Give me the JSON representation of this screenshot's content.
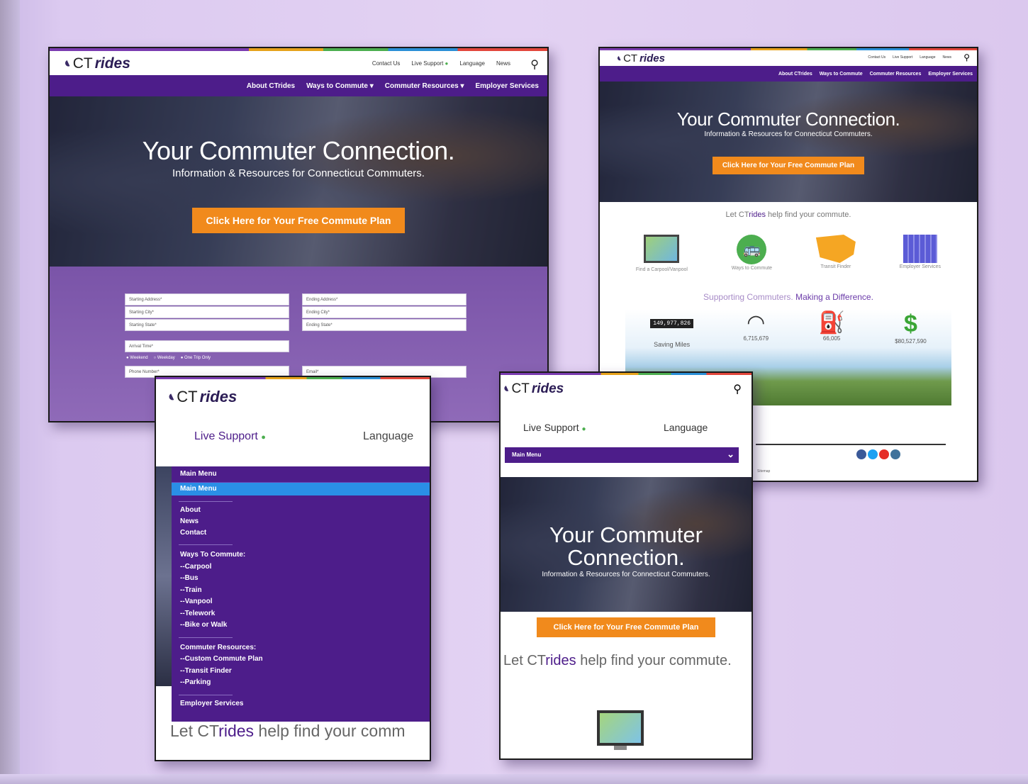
{
  "brand": {
    "ct": "CT",
    "rides": "rides",
    "let_prefix": "Let CT",
    "let_brand": "rides",
    "let_suffix": " help find your commute."
  },
  "colors": {
    "purple": "#4d1d8a",
    "orange": "#f18a1c",
    "green": "#4cae4f",
    "lavender_bg": "#e3d2f3"
  },
  "desktop_main": {
    "top_links": [
      "Contact Us",
      "Live Support",
      "Language",
      "News"
    ],
    "nav": [
      "About CTrides",
      "Ways to Commute",
      "Commuter Resources",
      "Employer Services"
    ],
    "hero_title": "Your Commuter Connection.",
    "hero_subtitle": "Information & Resources for Connecticut Commuters.",
    "cta": "Click Here for Your Free Commute Plan",
    "form": {
      "start_address": "Starting Address*",
      "start_city": "Starting City*",
      "start_state": "Starting State*",
      "end_address": "Ending Address*",
      "end_city": "Ending City*",
      "end_state": "Ending State*",
      "arrival": "Arrival Time*",
      "weekend": "Weekend",
      "weekday": "Weekday",
      "one_trip": "One Trip Only",
      "phone": "Phone Number*",
      "email": "Email*"
    }
  },
  "desktop_second": {
    "top_links": [
      "Contact Us",
      "Live Support",
      "Language",
      "News"
    ],
    "nav": [
      "About CTrides",
      "Ways to Commute",
      "Commuter Resources",
      "Employer Services"
    ],
    "hero_title": "Your Commuter Connection.",
    "hero_subtitle": "Information & Resources for Connecticut Commuters.",
    "cta": "Click Here for Your Free Commute Plan",
    "features": [
      "Find a Carpool/Vanpool",
      "Ways to Commute",
      "Transit Finder",
      "Employer Services"
    ],
    "supporting_a": "Supporting Commuters. ",
    "supporting_b": "Making a Difference.",
    "stats": [
      {
        "value": "149,977,826",
        "label": "Saving Miles"
      },
      {
        "value": "6,715,679",
        "label": ""
      },
      {
        "value": "66,005",
        "label": ""
      },
      {
        "value": "$80,527,590",
        "label": ""
      }
    ],
    "footer_link": "Sitemap"
  },
  "mobile_menu": {
    "live_support": "Live Support",
    "language": "Language",
    "main_menu": "Main Menu",
    "main_menu_selected": "Main Menu",
    "group1": [
      "About",
      "News",
      "Contact"
    ],
    "group2": [
      "Ways To Commute:",
      "--Carpool",
      "--Bus",
      "--Train",
      "--Vanpool",
      "--Telework",
      "--Bike or Walk"
    ],
    "group3": [
      "Commuter Resources:",
      "--Custom Commute Plan",
      "--Transit Finder",
      "--Parking"
    ],
    "group4": [
      "Employer Services"
    ],
    "let_text_prefix": "Let CT",
    "let_text_brand": "rides",
    "let_text_suffix": " help find your comm"
  },
  "mobile_home": {
    "live_support": "Live Support",
    "language": "Language",
    "main_menu": "Main Menu",
    "hero_title_1": "Your Commuter",
    "hero_title_2": "Connection.",
    "hero_subtitle": "Information & Resources for Connecticut Commuters.",
    "cta": "Click Here for Your Free Commute Plan",
    "let_text_prefix": "Let CT",
    "let_text_brand": "rides",
    "let_text_suffix": " help find your commute."
  }
}
